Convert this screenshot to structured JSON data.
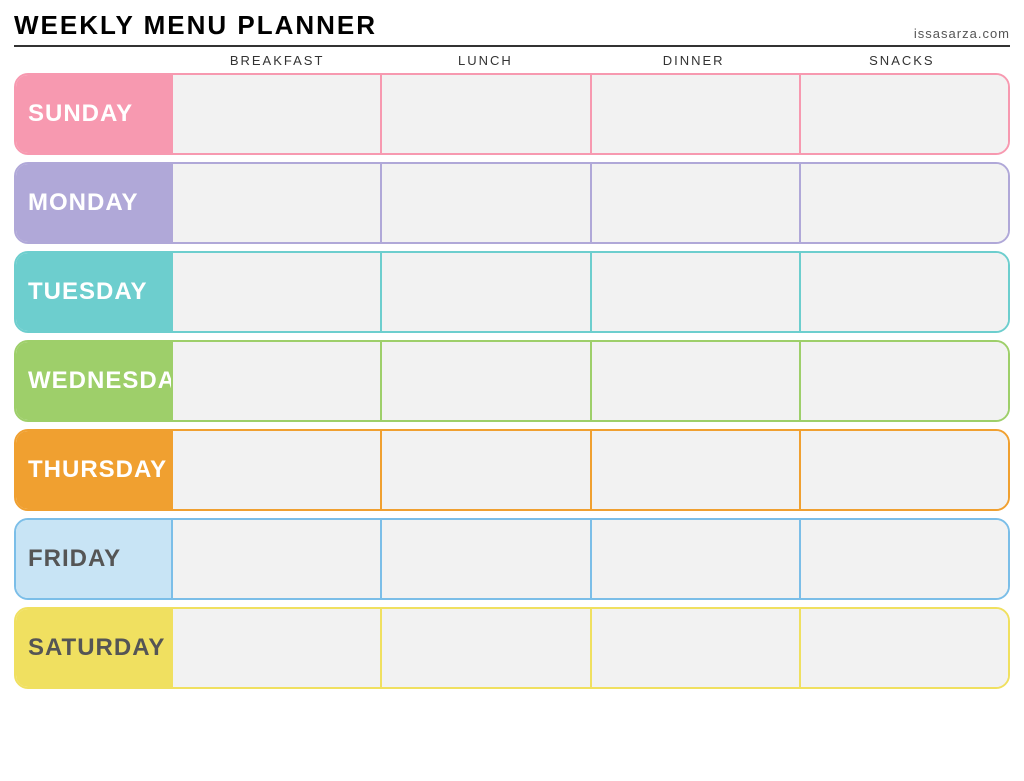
{
  "header": {
    "title": "Weekly Menu Planner",
    "website": "issasarza.com"
  },
  "columns": {
    "spacer": "",
    "breakfast": "Breakfast",
    "lunch": "Lunch",
    "dinner": "Dinner",
    "snacks": "Snacks"
  },
  "days": [
    {
      "id": "sunday",
      "label": "Sunday",
      "class": "row-sunday"
    },
    {
      "id": "monday",
      "label": "Monday",
      "class": "row-monday"
    },
    {
      "id": "tuesday",
      "label": "Tuesday",
      "class": "row-tuesday"
    },
    {
      "id": "wednesday",
      "label": "Wednesday",
      "class": "row-wednesday"
    },
    {
      "id": "thursday",
      "label": "Thursday",
      "class": "row-thursday"
    },
    {
      "id": "friday",
      "label": "Friday",
      "class": "row-friday"
    },
    {
      "id": "saturday",
      "label": "Saturday",
      "class": "row-saturday"
    }
  ]
}
